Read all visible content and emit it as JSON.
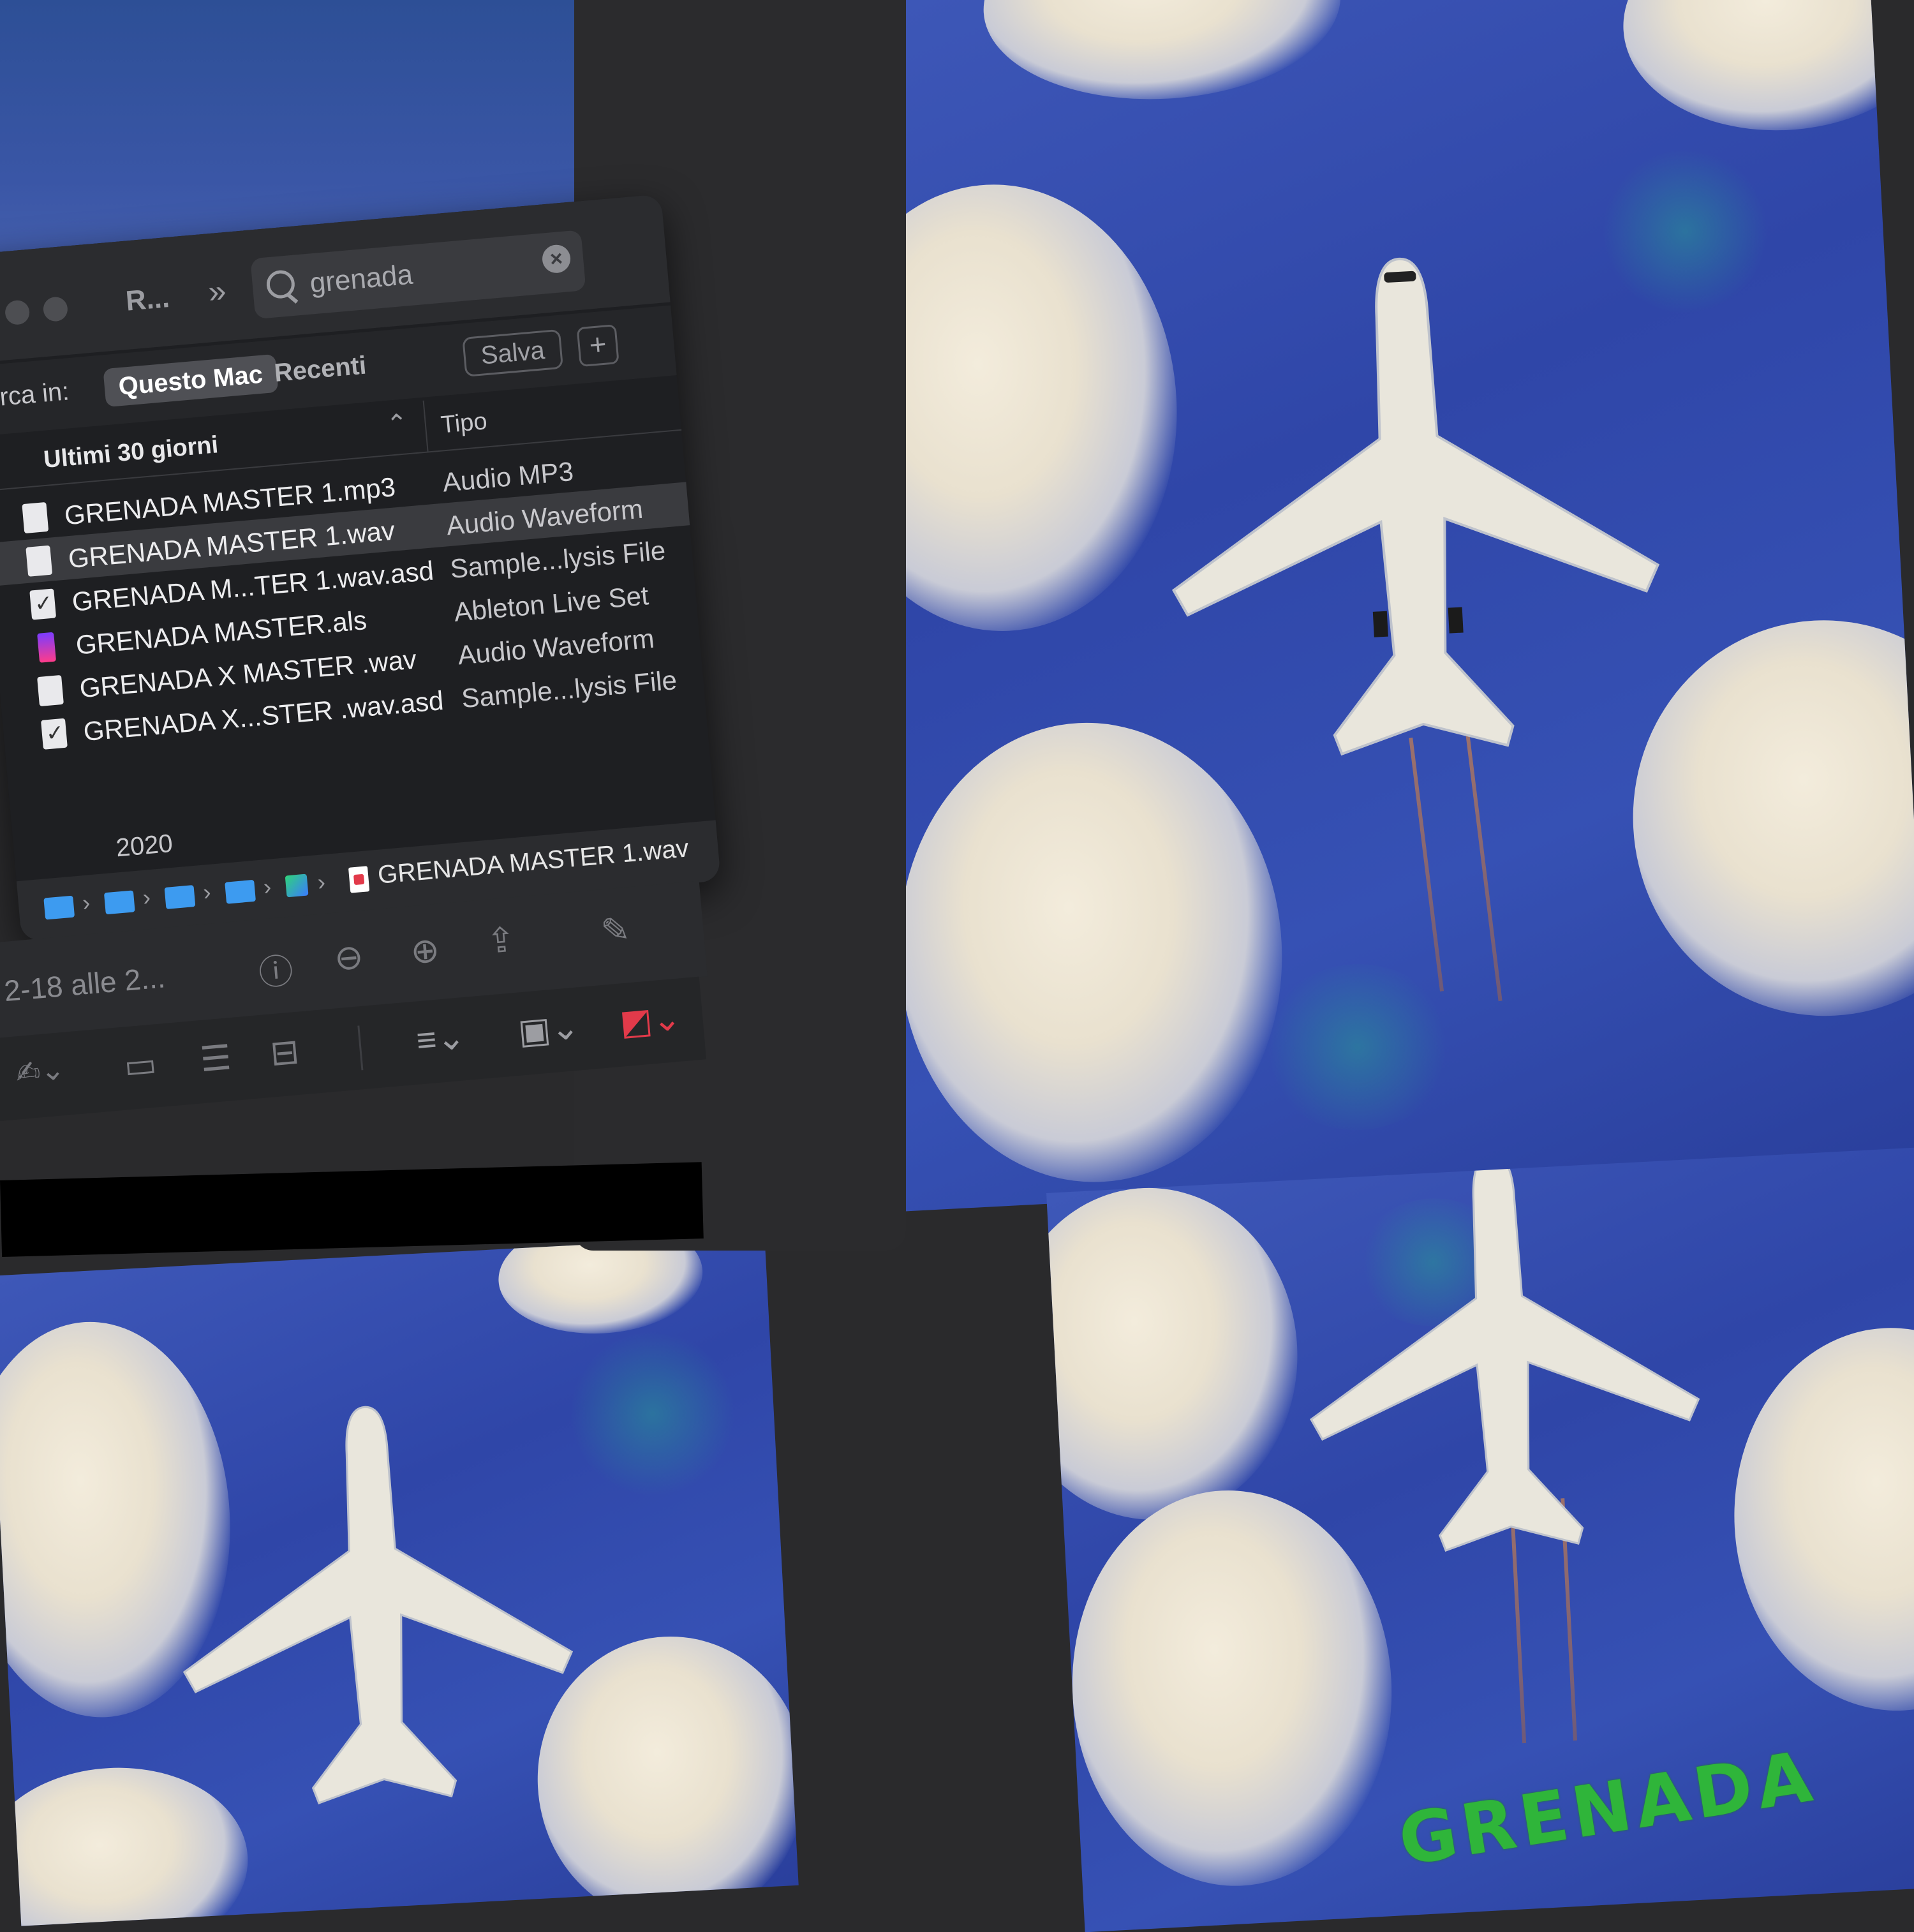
{
  "finder": {
    "window_title": "R...",
    "search": {
      "query": "grenada"
    },
    "scope": {
      "label": "rca in:",
      "options": [
        "Questo Mac",
        "Recenti"
      ],
      "save_label": "Salva",
      "add_label": "+"
    },
    "columns": {
      "name_header": "Ultimi 30 giorni",
      "type_header": "Tipo"
    },
    "files": [
      {
        "name": "GRENADA MASTER 1.mp3",
        "type": "Audio MP3",
        "icon": "audio-file-icon"
      },
      {
        "name": "GRENADA MASTER 1.wav",
        "type": "Audio Waveform",
        "icon": "audio-file-icon",
        "selected": true
      },
      {
        "name": "GRENADA M...TER 1.wav.asd",
        "type": "Sample...lysis File",
        "icon": "document-check-icon"
      },
      {
        "name": "GRENADA MASTER.als",
        "type": "Ableton Live Set",
        "icon": "ableton-file-icon"
      },
      {
        "name": "GRENADA X MASTER .wav",
        "type": "Audio Waveform",
        "icon": "audio-file-icon"
      },
      {
        "name": "GRENADA X...STER .wav.asd",
        "type": "Sample...lysis File",
        "icon": "document-check-icon"
      }
    ],
    "group_year": "2020",
    "path_file": "GRENADA MASTER 1.wav"
  },
  "preview": {
    "date_text": "2-18 alle 2...",
    "toolbar_icons": [
      "info-icon",
      "zoom-out-icon",
      "zoom-in-icon",
      "share-icon",
      "markup-pen-icon"
    ],
    "toolbar2_icons": [
      "signature-icon",
      "window-icon",
      "adjust-icon",
      "layout-icon",
      "lines-icon",
      "border-icon",
      "color-icon"
    ]
  },
  "artwork": {
    "logo_text": "GRENADA"
  },
  "colors": {
    "accent": "#3d9bf0",
    "sky": "#3551b3",
    "cloud": "#efe8d8",
    "logo": "#2fb53a"
  }
}
